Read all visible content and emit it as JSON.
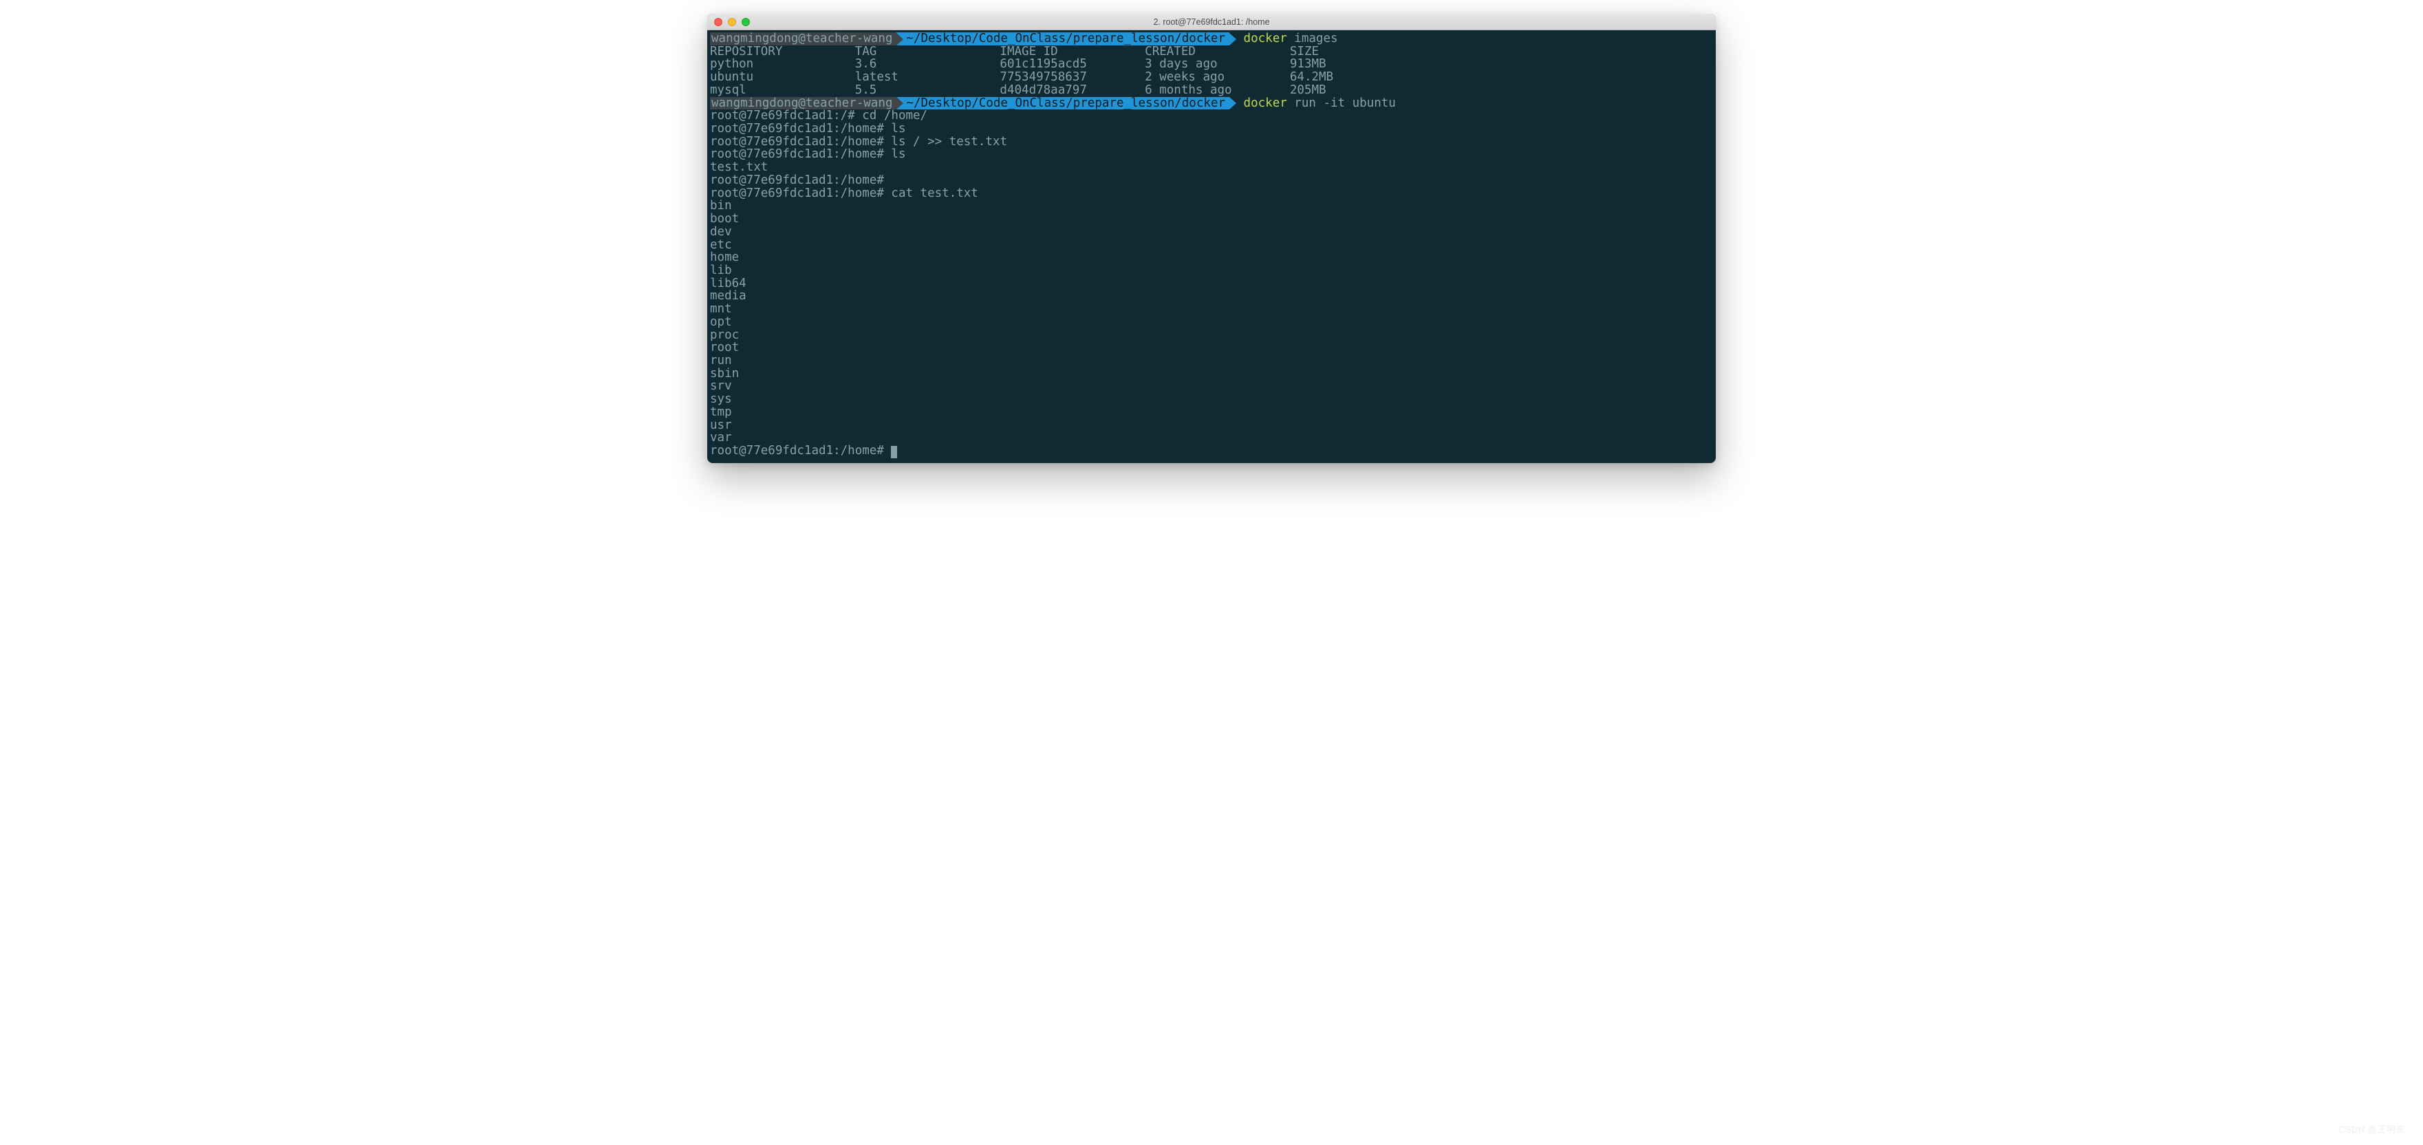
{
  "window": {
    "title": "2. root@77e69fdc1ad1: /home"
  },
  "prompts": [
    {
      "user": "wangmingdong@teacher-wang",
      "path": "~/Desktop/Code_OnClass/prepare_lesson/docker",
      "cmd_name": "docker",
      "cmd_args": " images"
    },
    {
      "user": "wangmingdong@teacher-wang",
      "path": "~/Desktop/Code_OnClass/prepare_lesson/docker",
      "cmd_name": "docker",
      "cmd_args": " run -it ubuntu"
    }
  ],
  "table": {
    "headers": {
      "c0": "REPOSITORY",
      "c1": "TAG",
      "c2": "IMAGE ID",
      "c3": "CREATED",
      "c4": "SIZE"
    },
    "rows": [
      {
        "c0": "python",
        "c1": "3.6",
        "c2": "601c1195acd5",
        "c3": "3 days ago",
        "c4": "913MB"
      },
      {
        "c0": "ubuntu",
        "c1": "latest",
        "c2": "775349758637",
        "c3": "2 weeks ago",
        "c4": "64.2MB"
      },
      {
        "c0": "mysql",
        "c1": "5.5",
        "c2": "d404d78aa797",
        "c3": "6 months ago",
        "c4": "205MB"
      }
    ]
  },
  "session": {
    "p1_prompt": "root@77e69fdc1ad1:/# ",
    "p1_cmd": "cd /home/",
    "p2_prompt": "root@77e69fdc1ad1:/home# ",
    "p2_cmd": "ls",
    "p3_prompt": "root@77e69fdc1ad1:/home# ",
    "p3_cmd": "ls / >> test.txt",
    "p4_prompt": "root@77e69fdc1ad1:/home# ",
    "p4_cmd": "ls",
    "ls_out": "test.txt",
    "p5_prompt": "root@77e69fdc1ad1:/home#",
    "p6_prompt": "root@77e69fdc1ad1:/home# ",
    "p6_cmd": "cat test.txt",
    "cat_lines": [
      "bin",
      "boot",
      "dev",
      "etc",
      "home",
      "lib",
      "lib64",
      "media",
      "mnt",
      "opt",
      "proc",
      "root",
      "run",
      "sbin",
      "srv",
      "sys",
      "tmp",
      "usr",
      "var"
    ],
    "p7_prompt": "root@77e69fdc1ad1:/home# "
  },
  "watermark": "CSDN @王明东"
}
